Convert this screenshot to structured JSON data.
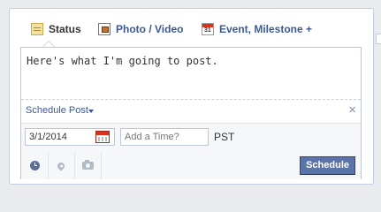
{
  "tabs": [
    {
      "label": "Status",
      "icon": "status-icon",
      "active": true
    },
    {
      "label": "Photo / Video",
      "icon": "photo-video-icon",
      "active": false
    },
    {
      "label": "Event, Milestone +",
      "icon": "calendar-icon",
      "active": false
    }
  ],
  "composer": {
    "text": "Here's what I'm going to post."
  },
  "schedule": {
    "label": "Schedule Post",
    "close": "×",
    "date_value": "3/1/2014",
    "time_placeholder": "Add a Time?",
    "timezone": "PST"
  },
  "footer": {
    "tools": [
      "clock-icon",
      "location-pin-icon",
      "camera-icon"
    ],
    "schedule_button": "Schedule"
  },
  "colors": {
    "link": "#3b5998",
    "button_bg": "#5b74a8",
    "border": "#bdc7d8"
  }
}
